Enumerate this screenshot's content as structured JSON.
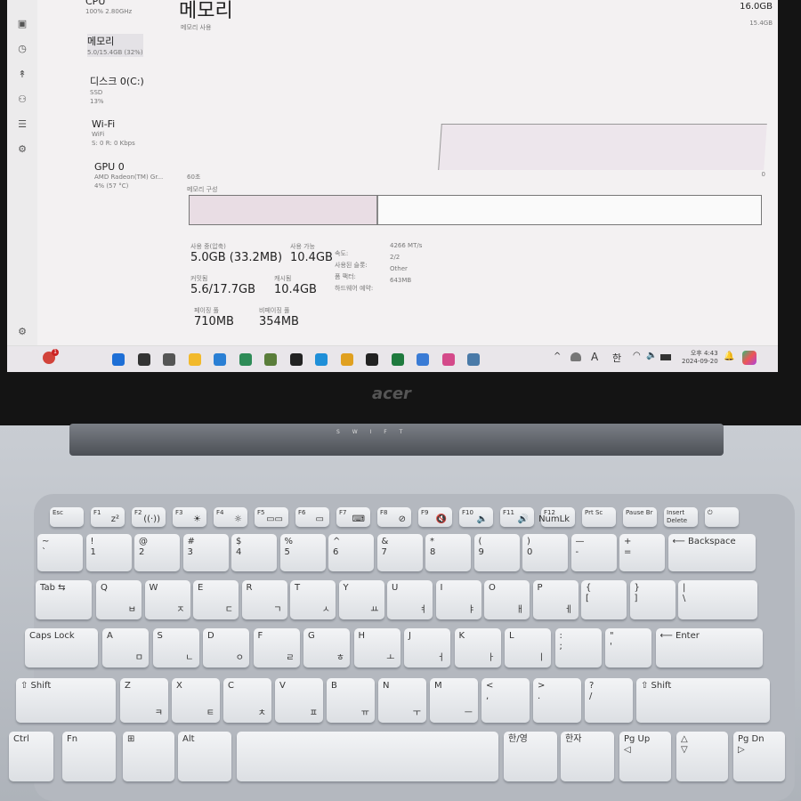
{
  "task_manager": {
    "sidebar_icons": [
      "performance-icon",
      "history-icon",
      "startup-icon",
      "users-icon",
      "details-icon",
      "services-icon",
      "settings-icon"
    ],
    "processes": [
      {
        "name": "CPU",
        "sub1": "100% 2.80GHz",
        "sub2": ""
      },
      {
        "name": "메모리",
        "sub1": "5.0/15.4GB (32%)",
        "sub2": ""
      },
      {
        "name": "디스크 0(C:)",
        "sub1": "SSD",
        "sub2": "13%"
      },
      {
        "name": "Wi-Fi",
        "sub1": "WiFi",
        "sub2": "S: 0 R: 0 Kbps"
      },
      {
        "name": "GPU 0",
        "sub1": "AMD Radeon(TM) Gr...",
        "sub2": "4% (57 °C)"
      }
    ],
    "title": "메모리",
    "subtitle": "메모리 사용",
    "total": "16.0GB",
    "graph_max": "15.4GB",
    "graph_time": "60초",
    "graph_min": "0",
    "composition_label": "메모리 구성",
    "memory_in_use_fraction": 0.33,
    "stats": [
      {
        "label": "사용 중(압축)",
        "value": "5.0GB (33.2MB)"
      },
      {
        "label": "사용 가능",
        "value": "10.4GB"
      },
      {
        "label": "커밋됨",
        "value": "5.6/17.7GB"
      },
      {
        "label": "캐시됨",
        "value": "10.4GB"
      },
      {
        "label": "페이징 풀",
        "value": "710MB"
      },
      {
        "label": "비페이징 풀",
        "value": "354MB"
      }
    ],
    "details": [
      {
        "label": "속도:",
        "value": "4266 MT/s"
      },
      {
        "label": "사용된 슬롯:",
        "value": "2/2"
      },
      {
        "label": "폼 팩터:",
        "value": "Other"
      },
      {
        "label": "하드웨어 예약:",
        "value": "643MB"
      }
    ]
  },
  "taskbar": {
    "notification_badge": "1",
    "apps": [
      "start",
      "search",
      "task-view",
      "file-explorer",
      "store",
      "app",
      "notes",
      "notion",
      "edge",
      "chrome",
      "terminal",
      "excel",
      "notepad",
      "itunes",
      "task-manager"
    ],
    "app_colors": [
      "#1e6fd6",
      "#333333",
      "#555555",
      "#f2b92b",
      "#2a7fd4",
      "#2e8b57",
      "#5a7d3a",
      "#222222",
      "#1f8fd8",
      "#e0a020",
      "#222222",
      "#1f7a3e",
      "#3a7bd5",
      "#d44a8a",
      "#4a7aa8"
    ],
    "tray": {
      "lang": "A",
      "ime": "한",
      "time": "오후 4:43",
      "date": "2024-09-20"
    }
  },
  "laptop": {
    "brand": "acer",
    "indicators": "S  W  I  F  T"
  },
  "keyboard": {
    "fn_row": [
      [
        "Esc",
        ""
      ],
      [
        "F1",
        "z²"
      ],
      [
        "F2",
        "((·))"
      ],
      [
        "F3",
        "☀"
      ],
      [
        "F4",
        "☼"
      ],
      [
        "F5",
        "▭▭"
      ],
      [
        "F6",
        "▭"
      ],
      [
        "F7",
        "⌨"
      ],
      [
        "F8",
        "⊘"
      ],
      [
        "F9",
        "🔇"
      ],
      [
        "F10",
        "🔈"
      ],
      [
        "F11",
        "🔊"
      ],
      [
        "F12",
        "NumLk"
      ],
      [
        "Prt Sc",
        ""
      ],
      [
        "Pause Br",
        ""
      ],
      [
        "Insert Delete",
        ""
      ],
      [
        "⏻",
        ""
      ]
    ],
    "row1": [
      [
        "~\n`",
        ""
      ],
      [
        "!\n1",
        ""
      ],
      [
        "@\n2",
        ""
      ],
      [
        "#\n3",
        ""
      ],
      [
        "$\n4",
        ""
      ],
      [
        "%\n5",
        ""
      ],
      [
        "^\n6",
        ""
      ],
      [
        "&\n7",
        ""
      ],
      [
        "*\n8",
        ""
      ],
      [
        "(\n9",
        ""
      ],
      [
        ")\n0",
        ""
      ],
      [
        "—\n-",
        ""
      ],
      [
        "+\n=",
        ""
      ],
      [
        "⟵ Backspace",
        ""
      ]
    ],
    "row2": [
      [
        "Tab ⇆",
        ""
      ],
      [
        "Q",
        "ㅂ"
      ],
      [
        "W",
        "ㅈ"
      ],
      [
        "E",
        "ㄷ"
      ],
      [
        "R",
        "ㄱ"
      ],
      [
        "T",
        "ㅅ"
      ],
      [
        "Y",
        "ㅛ"
      ],
      [
        "U",
        "ㅕ"
      ],
      [
        "I",
        "ㅑ"
      ],
      [
        "O",
        "ㅐ"
      ],
      [
        "P",
        "ㅔ"
      ],
      [
        "{\n[",
        ""
      ],
      [
        "}\n]",
        ""
      ],
      [
        "|\n\\",
        ""
      ]
    ],
    "row3": [
      [
        "Caps Lock",
        ""
      ],
      [
        "A",
        "ㅁ"
      ],
      [
        "S",
        "ㄴ"
      ],
      [
        "D",
        "ㅇ"
      ],
      [
        "F",
        "ㄹ"
      ],
      [
        "G",
        "ㅎ"
      ],
      [
        "H",
        "ㅗ"
      ],
      [
        "J",
        "ㅓ"
      ],
      [
        "K",
        "ㅏ"
      ],
      [
        "L",
        "ㅣ"
      ],
      [
        ":\n;",
        ""
      ],
      [
        "\"\n'",
        ""
      ],
      [
        "⟵ Enter",
        ""
      ]
    ],
    "row4": [
      [
        "⇧ Shift",
        ""
      ],
      [
        "Z",
        "ㅋ"
      ],
      [
        "X",
        "ㅌ"
      ],
      [
        "C",
        "ㅊ"
      ],
      [
        "V",
        "ㅍ"
      ],
      [
        "B",
        "ㅠ"
      ],
      [
        "N",
        "ㅜ"
      ],
      [
        "M",
        "ㅡ"
      ],
      [
        "<\n,",
        ""
      ],
      [
        ">\n.",
        ""
      ],
      [
        "?\n/",
        ""
      ],
      [
        "⇧ Shift",
        ""
      ]
    ],
    "row5": [
      [
        "Ctrl",
        ""
      ],
      [
        "Fn",
        ""
      ],
      [
        "⊞",
        ""
      ],
      [
        "Alt",
        ""
      ],
      [
        "",
        ""
      ],
      [
        "한/영",
        ""
      ],
      [
        "한자",
        ""
      ],
      [
        "Pg Up\n◁",
        ""
      ],
      [
        "△\n▽",
        ""
      ],
      [
        "Pg Dn\n▷",
        ""
      ]
    ]
  }
}
